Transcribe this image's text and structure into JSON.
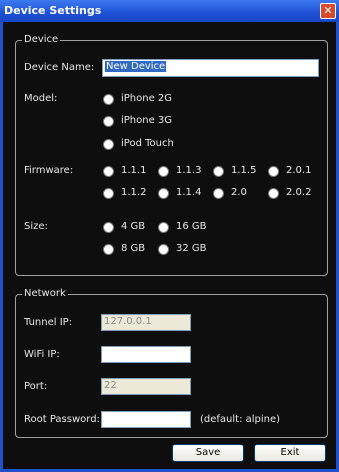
{
  "window": {
    "title": "Device Settings",
    "close_glyph": "✕"
  },
  "device_group": {
    "legend": "Device",
    "name_label": "Device Name:",
    "name_value": "New Device",
    "model_label": "Model:",
    "models": [
      "iPhone 2G",
      "iPhone 3G",
      "iPod Touch"
    ],
    "firmware_label": "Firmware:",
    "firmware_row1": [
      "1.1.1",
      "1.1.3",
      "1.1.5",
      "2.0.1"
    ],
    "firmware_row2": [
      "1.1.2",
      "1.1.4",
      "2.0",
      "2.0.2"
    ],
    "size_label": "Size:",
    "size_row1": [
      "4 GB",
      "16 GB"
    ],
    "size_row2": [
      "8 GB",
      "32 GB"
    ]
  },
  "network_group": {
    "legend": "Network",
    "tunnel_label": "Tunnel IP:",
    "tunnel_value": "127.0.0.1",
    "wifi_label": "WiFi IP:",
    "wifi_value": "",
    "port_label": "Port:",
    "port_value": "22",
    "password_label": "Root Password:",
    "password_value": "",
    "password_hint": "(default: alpine)"
  },
  "buttons": {
    "save": "Save",
    "exit": "Exit"
  },
  "colors": {
    "titlebar": "#2a60e0",
    "background": "#0e0e0e",
    "selection": "#316ac5"
  }
}
